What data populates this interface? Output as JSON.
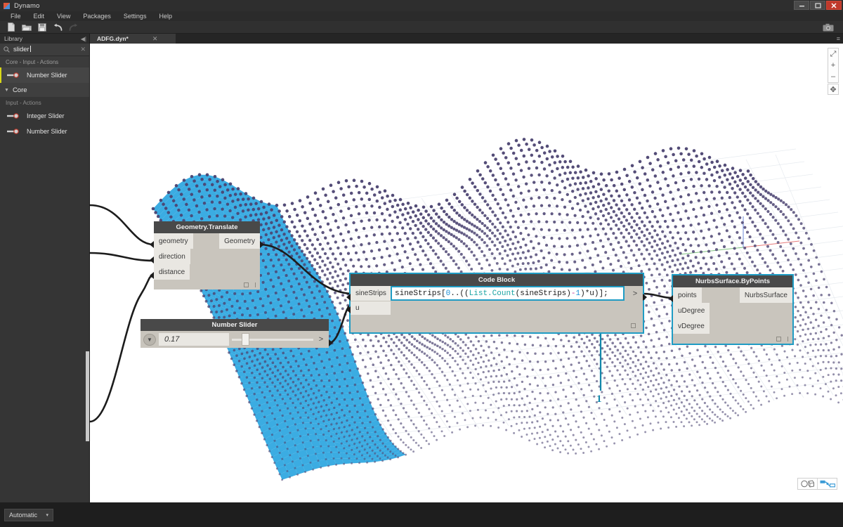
{
  "window": {
    "title": "Dynamo",
    "logo_icon": "dynamo-logo-icon",
    "minimize_label": "–",
    "maximize_label": "❐",
    "close_label": "✕"
  },
  "menu": {
    "items": [
      {
        "label": "File"
      },
      {
        "label": "Edit"
      },
      {
        "label": "View"
      },
      {
        "label": "Packages"
      },
      {
        "label": "Settings"
      },
      {
        "label": "Help"
      }
    ]
  },
  "toolbar": {
    "buttons": [
      {
        "name": "new-file-icon",
        "tooltip": "New"
      },
      {
        "name": "open-file-icon",
        "tooltip": "Open"
      },
      {
        "name": "save-file-icon",
        "tooltip": "Save"
      },
      {
        "name": "undo-icon",
        "tooltip": "Undo"
      },
      {
        "name": "redo-icon",
        "tooltip": "Redo"
      }
    ],
    "camera_icon": "camera-icon"
  },
  "tabs": {
    "items": [
      {
        "label": "ADFG.dyn*",
        "close_label": "✕",
        "active": true
      }
    ],
    "overflow_label": "≡"
  },
  "library": {
    "header_title": "Library",
    "collapse_label": "◀|",
    "search": {
      "value": "slider",
      "placeholder": "Search",
      "icon": "search-icon",
      "clear_label": "✕"
    },
    "results_category": "Core - Input - Actions",
    "top_result": {
      "label": "Number Slider",
      "icon": "slider-icon"
    },
    "group": {
      "label": "Core",
      "chevron": "▼"
    },
    "group_category": "Input - Actions",
    "group_items": [
      {
        "label": "Integer Slider",
        "icon": "slider-icon"
      },
      {
        "label": "Number Slider",
        "icon": "slider-icon"
      }
    ]
  },
  "canvas": {
    "view_controls": {
      "fit_label": "⤢",
      "zoom_in_label": "+",
      "zoom_out_label": "–",
      "pan_label": "✥"
    },
    "view_toggles": [
      {
        "name": "geometry-view-toggle",
        "icon": "geometry-preview-icon"
      },
      {
        "name": "graph-view-toggle",
        "icon": "node-graph-icon"
      }
    ],
    "annotation": {
      "number": "1"
    }
  },
  "nodes": {
    "geometry_translate": {
      "title": "Geometry.Translate",
      "inputs": [
        "geometry",
        "direction",
        "distance"
      ],
      "outputs": [
        "Geometry"
      ]
    },
    "code_block": {
      "title": "Code Block",
      "inputs": [
        "sineStrips",
        "u"
      ],
      "expand_label": ">",
      "code_tokens": [
        {
          "text": "sineStrips[",
          "type": "plain"
        },
        {
          "text": "0",
          "type": "num"
        },
        {
          "text": "..((",
          "type": "plain"
        },
        {
          "text": "List.Count",
          "type": "func"
        },
        {
          "text": "(sineStrips)",
          "type": "plain"
        },
        {
          "text": "-",
          "type": "op"
        },
        {
          "text": "1",
          "type": "num"
        },
        {
          "text": ")*u)];",
          "type": "plain"
        }
      ],
      "code_text": "sineStrips[0..((List.Count(sineStrips)-1)*u)];"
    },
    "nurbs_surface": {
      "title": "NurbsSurface.ByPoints",
      "inputs": [
        "points",
        "uDegree",
        "vDegree"
      ],
      "outputs": [
        "NurbsSurface"
      ]
    },
    "number_slider": {
      "title": "Number Slider",
      "value": "0.17",
      "chevron_label": "▼",
      "next_label": ">"
    }
  },
  "statusbar": {
    "run_mode": "Automatic",
    "run_mode_chevron": "▾"
  },
  "colors": {
    "accent_teal": "#1f9cc4",
    "selection_blue": "#2aa5e0",
    "point_purple": "#4a4270",
    "node_header": "#494949",
    "node_body": "#c9c5bd",
    "highlight_yellow": "#d8d817"
  }
}
